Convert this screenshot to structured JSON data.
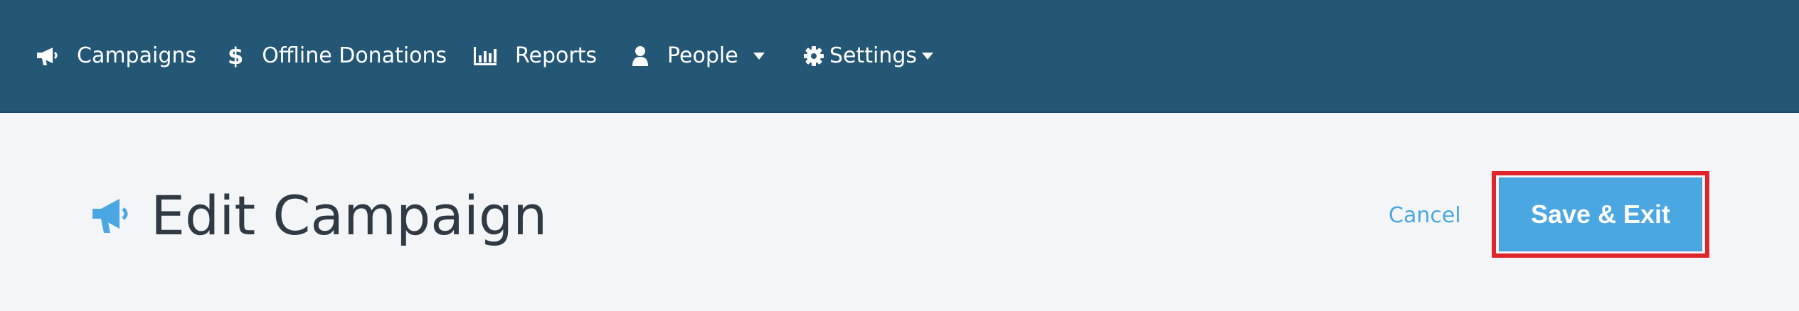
{
  "nav": {
    "items": [
      {
        "label": "Campaigns",
        "icon": "bullhorn-icon"
      },
      {
        "label": "Offline Donations",
        "icon": "dollar-icon"
      },
      {
        "label": "Reports",
        "icon": "bar-chart-icon"
      },
      {
        "label": "People",
        "icon": "user-icon",
        "has_dropdown": true
      },
      {
        "label": "Settings",
        "icon": "gear-icon",
        "has_dropdown": true
      }
    ]
  },
  "header": {
    "title": "Edit Campaign",
    "icon": "bullhorn-icon",
    "cancel_label": "Cancel",
    "save_label": "Save & Exit"
  },
  "colors": {
    "nav_background": "#245676",
    "page_background": "#f4f5f7",
    "accent": "#4aa7e2",
    "title_text": "#2f3a44",
    "highlight_border": "#e0242c"
  }
}
